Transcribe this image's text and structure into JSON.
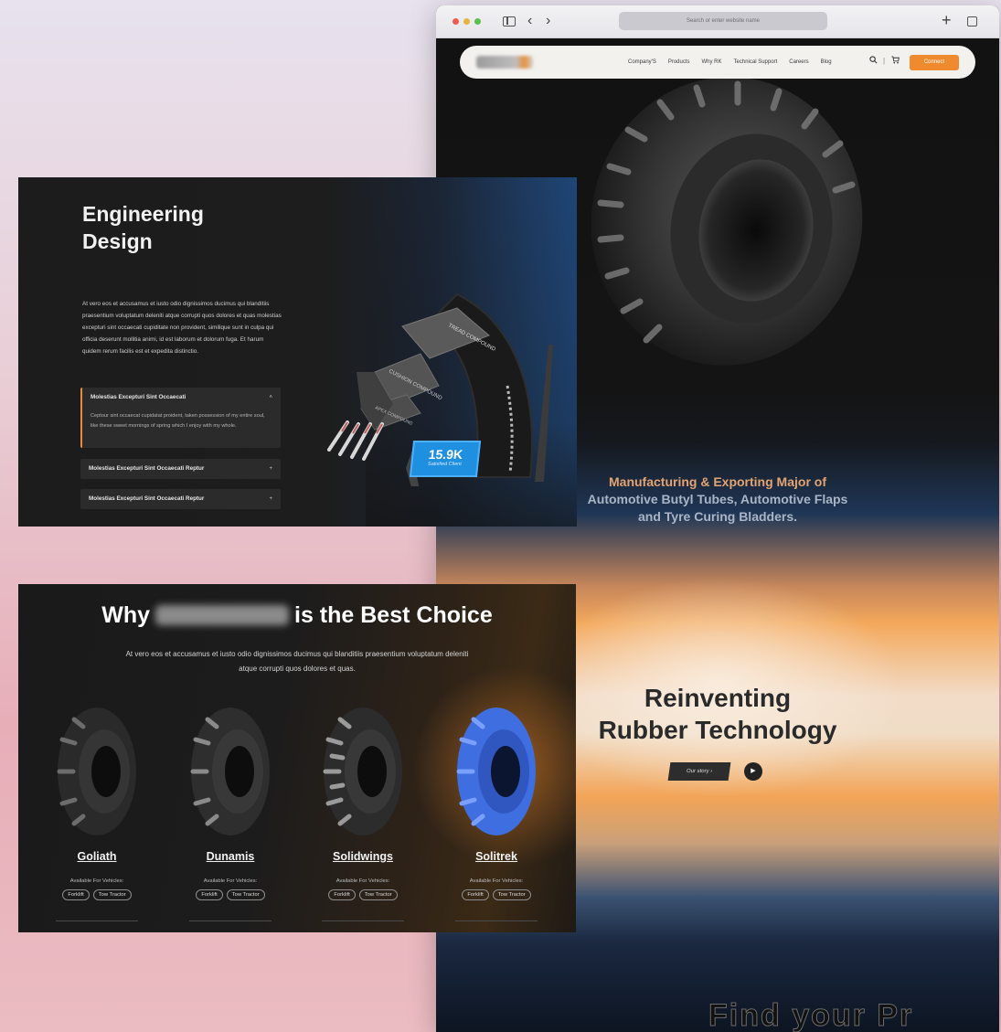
{
  "browser": {
    "address_placeholder": "Search or enter website name",
    "back_glyph": "‹",
    "forward_glyph": "›",
    "new_tab_glyph": "+"
  },
  "nav": {
    "links": [
      "Company'S",
      "Products",
      "Why RK",
      "Technical Support",
      "Careers",
      "Blog"
    ],
    "connect_label": "Connect",
    "search_icon": "search-icon",
    "cart_icon": "cart-icon"
  },
  "hero": {
    "subtitle_line1": "Manufacturing & Exporting Major of",
    "subtitle_line2": "Automotive Butyl Tubes, Automotive Flaps",
    "subtitle_line3": "and Tyre Curing Bladders.",
    "headline_line1": "Reinventing",
    "headline_line2": "Rubber Technology",
    "story_button": "Our story ›",
    "play_icon": "play-icon",
    "footer_text": "Find your Pr"
  },
  "engineering": {
    "title": "Engineering Design",
    "body": "At vero eos et accusamus et iusto odio dignissimos ducimus qui blanditiis praesentium voluptatum deleniti atque corrupti quos dolores et quas molestias excepturi sint occaecati cupiditate non provident, similique sunt in culpa qui officia deserunt mollitia animi, id est laborum et dolorum fuga. Et harum quidem rerum facilis est et expedita distinctio.",
    "accordion": [
      {
        "title": "Molestias Excepturi Sint Occaecati",
        "text": "Ceptour sint occaecat cupidatat proident, taken possession of my entire soul, like these sweet mornings of spring which I enjoy with my whole.",
        "chevron": "˄"
      },
      {
        "title": "Molestias Excepturi Sint Occaecati Reptur",
        "chevron": "+"
      },
      {
        "title": "Molestias Excepturi Sint Occaecati Reptur",
        "chevron": "+"
      }
    ],
    "labels": [
      "TREAD COMPOUND",
      "CUSHION COMPOUND",
      "APEX COMPOUND"
    ],
    "stat_value": "15.9K",
    "stat_label": "Satisfied Client"
  },
  "why": {
    "title_start": "Why",
    "title_end": "is the Best Choice",
    "subtitle": "At vero eos et accusamus et iusto odio dignissimos ducimus qui blanditiis praesentium voluptatum deleniti atque corrupti quos dolores et quas.",
    "available_label": "Available For Vehicles:",
    "products": [
      {
        "name": "Goliath",
        "chips": [
          "Forklift",
          "Tow Tractor"
        ],
        "color": "#2a2a2a"
      },
      {
        "name": "Dunamis",
        "chips": [
          "Forklift",
          "Tow Tractor"
        ],
        "color": "#2e2e2e"
      },
      {
        "name": "Solidwings",
        "chips": [
          "Forklift",
          "Tow Tractor"
        ],
        "color": "#2c2c2c"
      },
      {
        "name": "Solitrek",
        "chips": [
          "Forklift",
          "Tow Tractor"
        ],
        "color": "#3f6ee0"
      }
    ]
  },
  "colors": {
    "accent_orange": "#ef8a2e",
    "badge_blue": "#1f8fe0"
  }
}
